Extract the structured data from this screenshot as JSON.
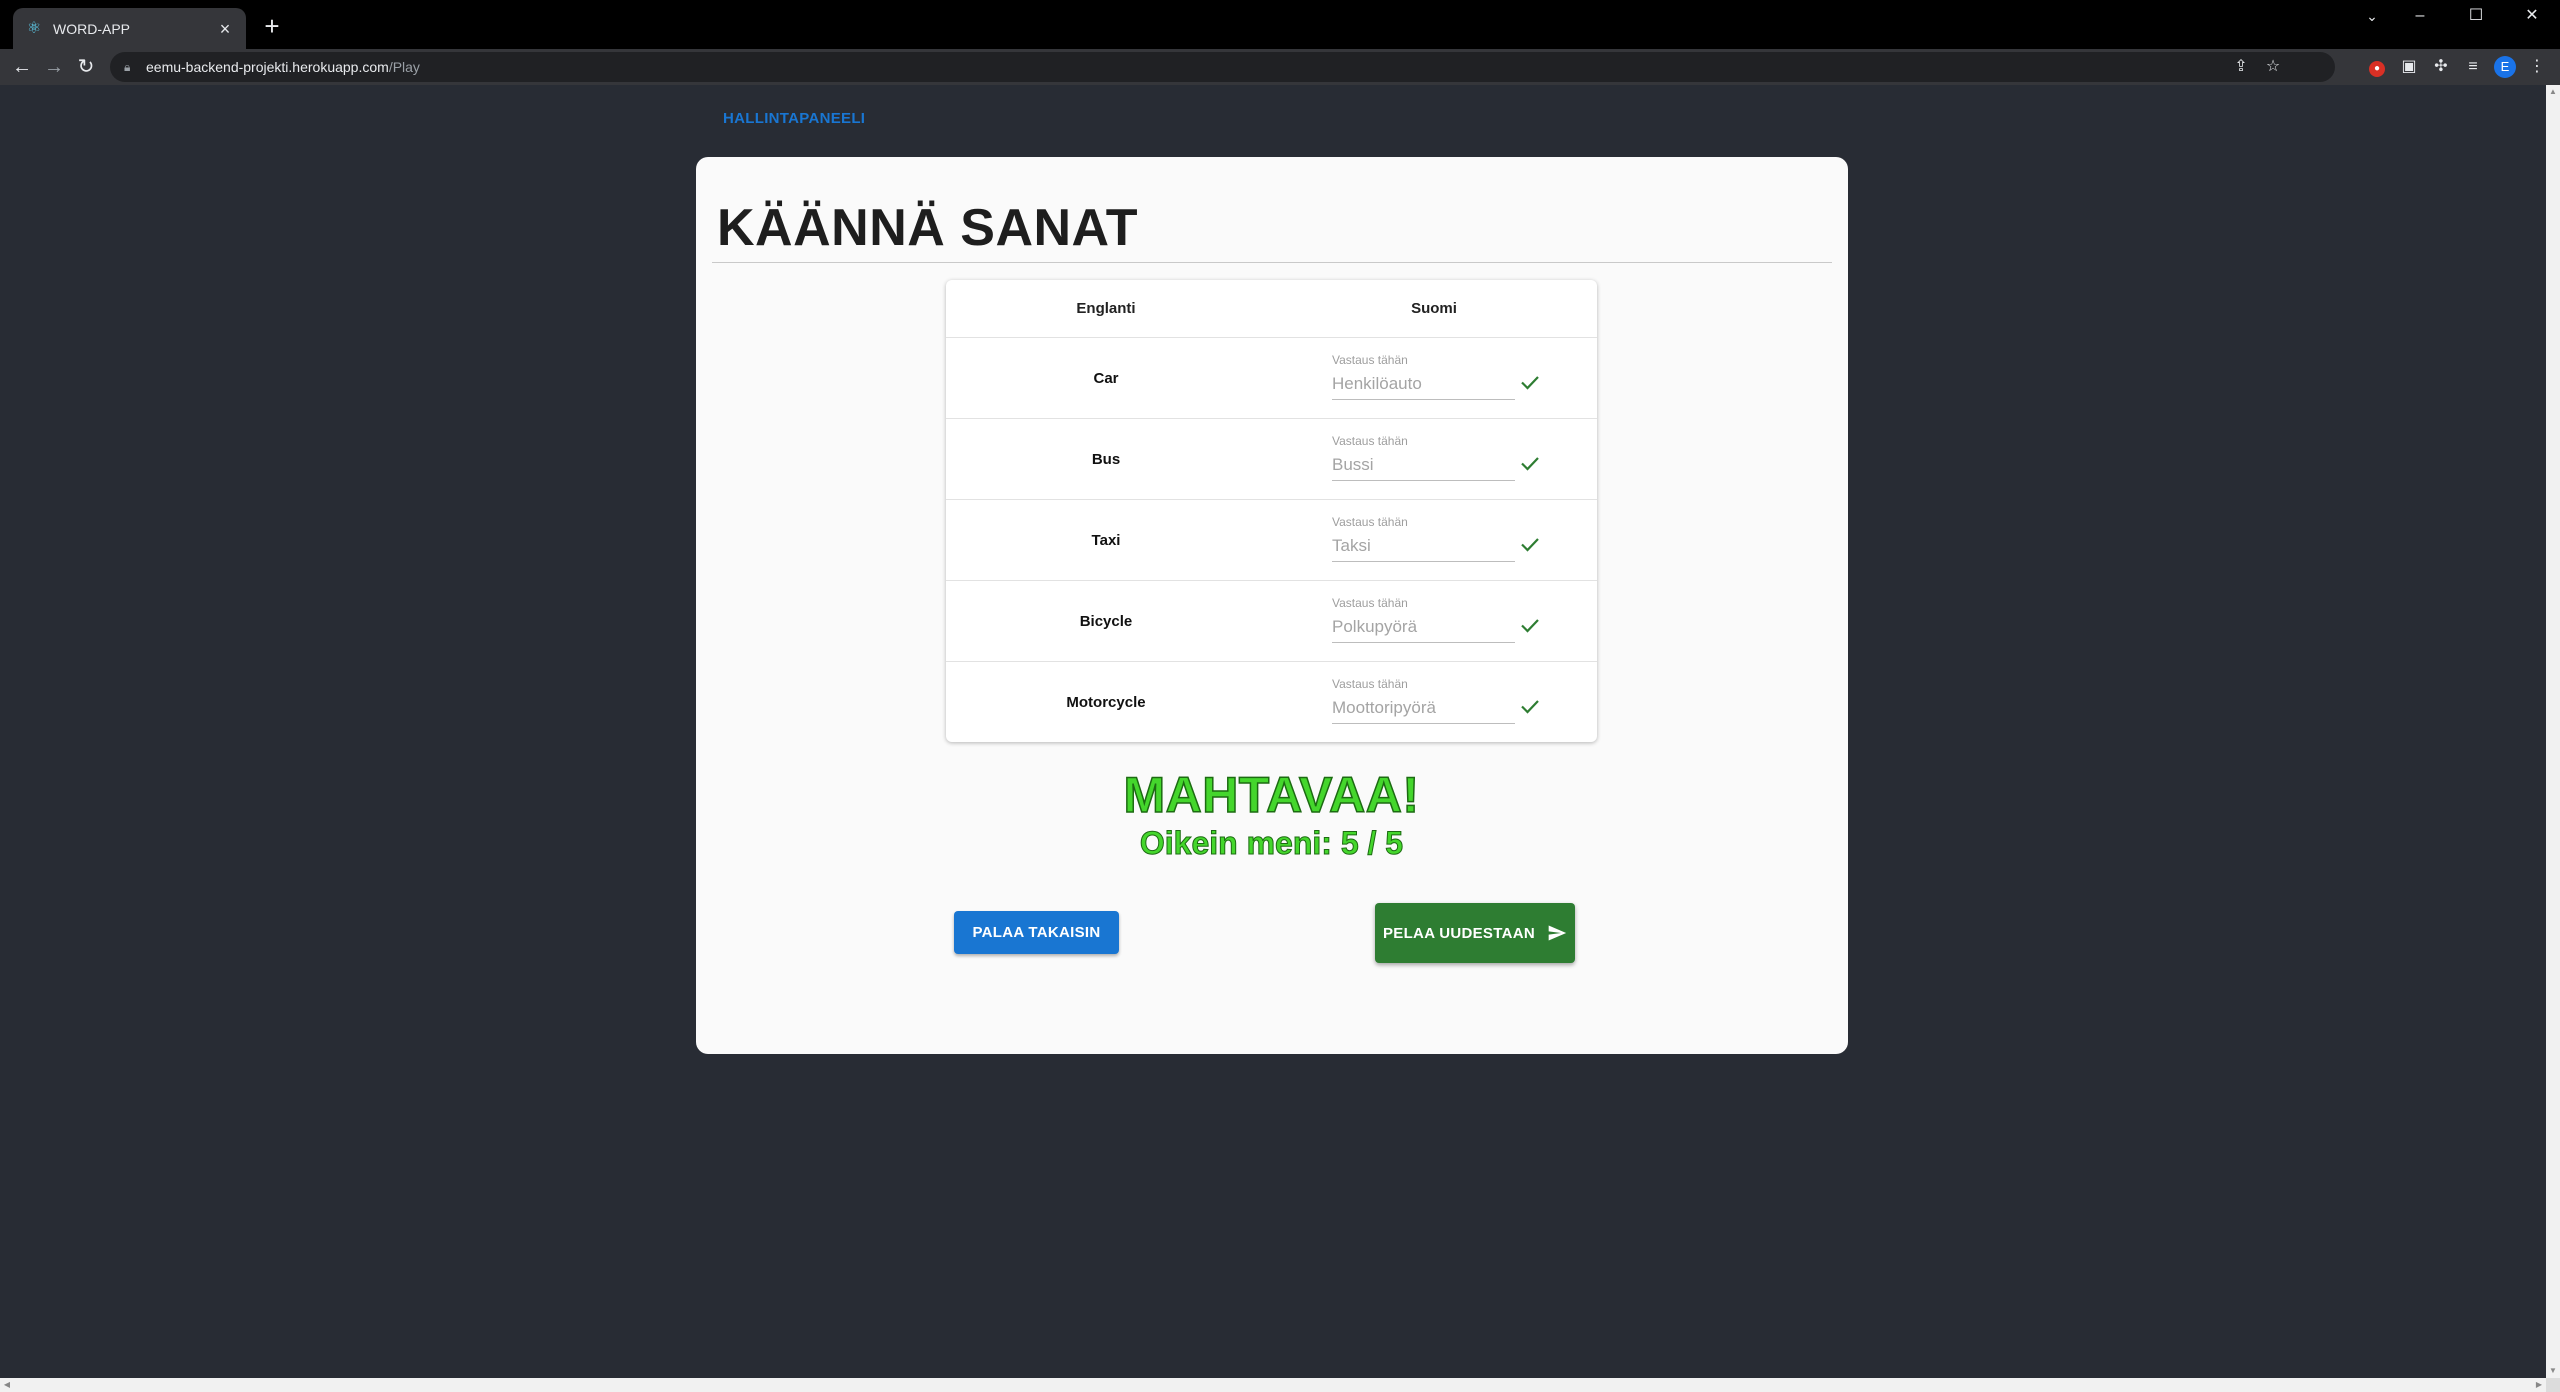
{
  "browser": {
    "tab_title": "WORD-APP",
    "tab_favicon": "react-icon",
    "url_host": "eemu-backend-projekti.herokuapp.com",
    "url_path": "/Play",
    "profile_initial": "E"
  },
  "page": {
    "nav_link": "HALLINTAPANEELI",
    "title": "KÄÄNNÄ SANAT",
    "table": {
      "col_source": "Englanti",
      "col_target": "Suomi",
      "field_label": "Vastaus tähän",
      "rows": [
        {
          "word": "Car",
          "answer": "Henkilöauto",
          "correct": true
        },
        {
          "word": "Bus",
          "answer": "Bussi",
          "correct": true
        },
        {
          "word": "Taxi",
          "answer": "Taksi",
          "correct": true
        },
        {
          "word": "Bicycle",
          "answer": "Polkupyörä",
          "correct": true
        },
        {
          "word": "Motorcycle",
          "answer": "Moottoripyörä",
          "correct": true
        }
      ]
    },
    "result_title": "MAHTAVAA!",
    "result_score": "Oikein meni: 5 / 5",
    "back_button": "PALAA TAKAISIN",
    "again_button": "PELAA UUDESTAAN"
  },
  "colors": {
    "page_bg": "#282c34",
    "card_bg": "#fafafa",
    "primary": "#1976d2",
    "success": "#2e7d32",
    "result_text": "#44d62c"
  }
}
